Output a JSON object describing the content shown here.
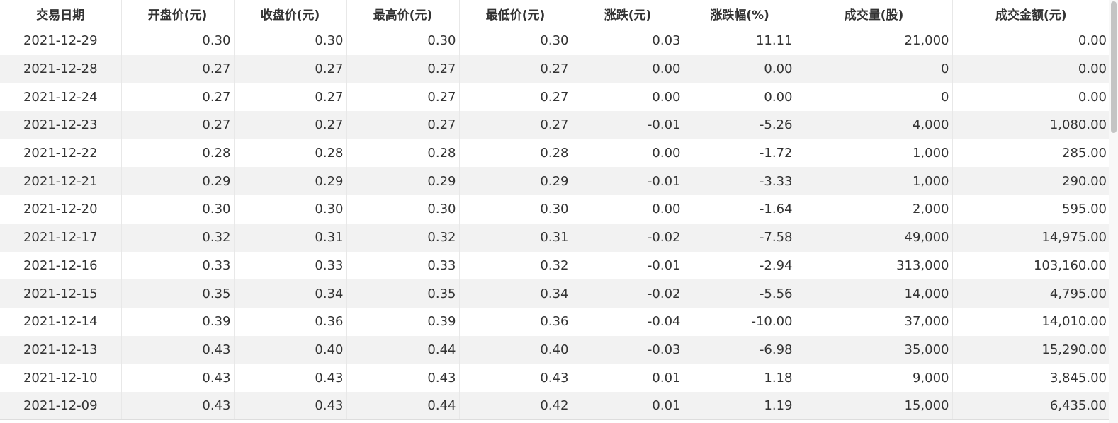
{
  "table": {
    "headers": [
      "交易日期",
      "开盘价(元)",
      "收盘价(元)",
      "最高价(元)",
      "最低价(元)",
      "涨跌(元)",
      "涨跌幅(%)",
      "成交量(股)",
      "成交金额(元)"
    ],
    "rows": [
      [
        "2021-12-29",
        "0.30",
        "0.30",
        "0.30",
        "0.30",
        "0.03",
        "11.11",
        "21,000",
        "0.00"
      ],
      [
        "2021-12-28",
        "0.27",
        "0.27",
        "0.27",
        "0.27",
        "0.00",
        "0.00",
        "0",
        "0.00"
      ],
      [
        "2021-12-24",
        "0.27",
        "0.27",
        "0.27",
        "0.27",
        "0.00",
        "0.00",
        "0",
        "0.00"
      ],
      [
        "2021-12-23",
        "0.27",
        "0.27",
        "0.27",
        "0.27",
        "-0.01",
        "-5.26",
        "4,000",
        "1,080.00"
      ],
      [
        "2021-12-22",
        "0.28",
        "0.28",
        "0.28",
        "0.28",
        "0.00",
        "-1.72",
        "1,000",
        "285.00"
      ],
      [
        "2021-12-21",
        "0.29",
        "0.29",
        "0.29",
        "0.29",
        "-0.01",
        "-3.33",
        "1,000",
        "290.00"
      ],
      [
        "2021-12-20",
        "0.30",
        "0.30",
        "0.30",
        "0.30",
        "0.00",
        "-1.64",
        "2,000",
        "595.00"
      ],
      [
        "2021-12-17",
        "0.32",
        "0.31",
        "0.32",
        "0.31",
        "-0.02",
        "-7.58",
        "49,000",
        "14,975.00"
      ],
      [
        "2021-12-16",
        "0.33",
        "0.33",
        "0.33",
        "0.32",
        "-0.01",
        "-2.94",
        "313,000",
        "103,160.00"
      ],
      [
        "2021-12-15",
        "0.35",
        "0.34",
        "0.35",
        "0.34",
        "-0.02",
        "-5.56",
        "14,000",
        "4,795.00"
      ],
      [
        "2021-12-14",
        "0.39",
        "0.36",
        "0.39",
        "0.36",
        "-0.04",
        "-10.00",
        "37,000",
        "14,010.00"
      ],
      [
        "2021-12-13",
        "0.43",
        "0.40",
        "0.44",
        "0.40",
        "-0.03",
        "-6.98",
        "35,000",
        "15,290.00"
      ],
      [
        "2021-12-10",
        "0.43",
        "0.43",
        "0.43",
        "0.43",
        "0.01",
        "1.18",
        "9,000",
        "3,845.00"
      ],
      [
        "2021-12-09",
        "0.43",
        "0.43",
        "0.44",
        "0.42",
        "0.01",
        "1.19",
        "15,000",
        "6,435.00"
      ]
    ]
  },
  "colors": {
    "stripe": "#f2f2f2",
    "divider": "#e8e8e8",
    "text": "#333333"
  }
}
